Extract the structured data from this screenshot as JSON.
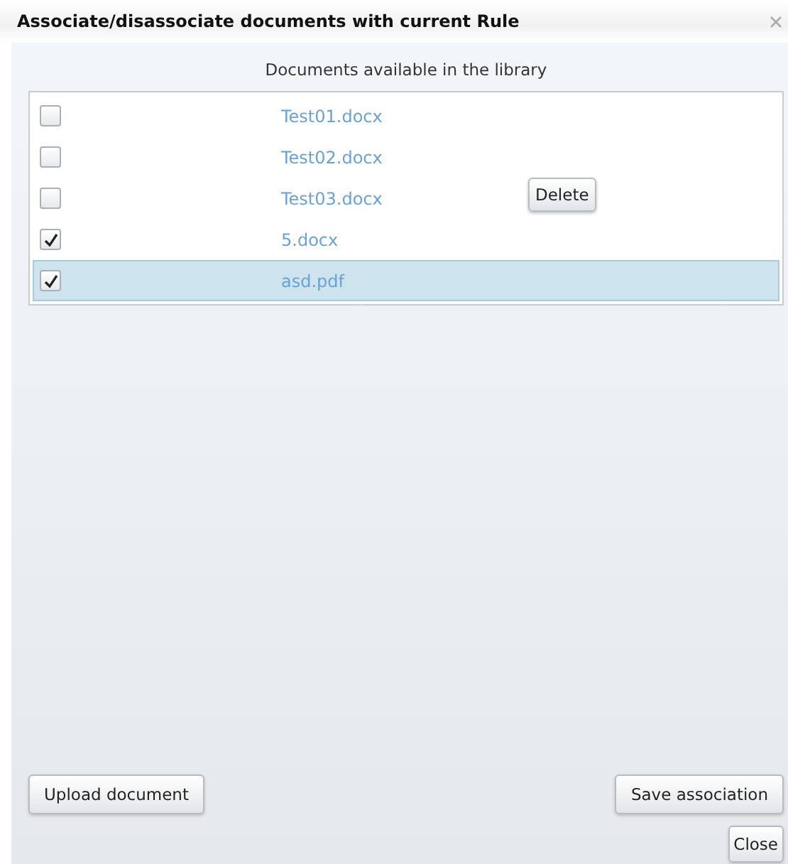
{
  "window": {
    "title": "Associate/disassociate documents with current Rule"
  },
  "list_heading": "Documents available in the library",
  "documents": [
    {
      "name": "Test01.docx",
      "checked": false,
      "selected": false
    },
    {
      "name": "Test02.docx",
      "checked": false,
      "selected": false
    },
    {
      "name": "Test03.docx",
      "checked": false,
      "selected": false
    },
    {
      "name": "5.docx",
      "checked": true,
      "selected": false
    },
    {
      "name": "asd.pdf",
      "checked": true,
      "selected": true
    }
  ],
  "delete_button": "Delete",
  "buttons": {
    "upload": "Upload document",
    "save": "Save association",
    "close": "Close"
  }
}
